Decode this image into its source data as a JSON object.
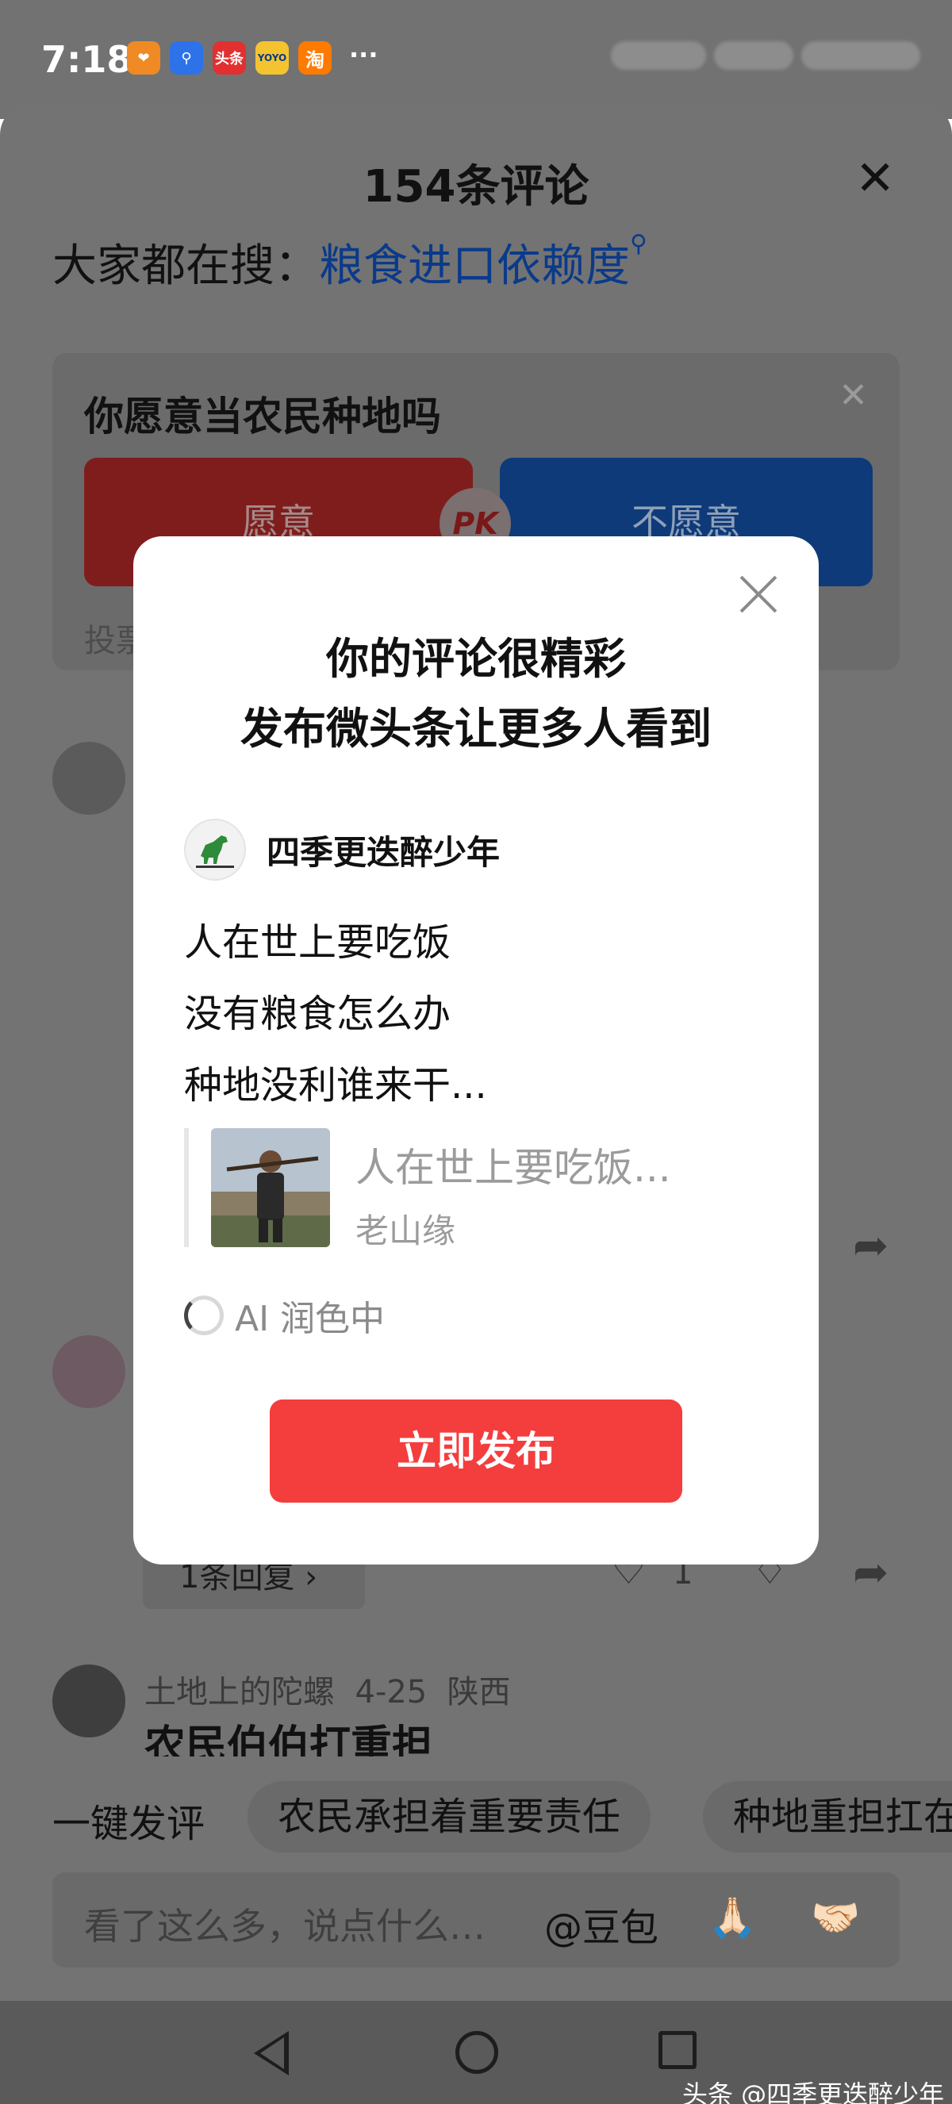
{
  "status_bar": {
    "time": "7:18",
    "app_icons": [
      {
        "name": "heart-app-icon",
        "label": "",
        "color": "#f08a24"
      },
      {
        "name": "map-pin-app-icon",
        "label": "",
        "color": "#2d72e8"
      },
      {
        "name": "toutiao-app-icon",
        "label": "头条",
        "color": "#e23030"
      },
      {
        "name": "youku-app-icon",
        "label": "YOYO",
        "color": "#f4c430"
      },
      {
        "name": "taobao-app-icon",
        "label": "淘",
        "color": "#ff7a00"
      }
    ],
    "more": "···"
  },
  "sheet": {
    "title": "154条评论",
    "close_icon": "close-icon",
    "search_prefix": "大家都在搜：",
    "search_keyword": "粮食进口依赖度"
  },
  "poll": {
    "question": "你愿意当农民种地吗",
    "yes_label": "愿意",
    "no_label": "不愿意",
    "pk_label": "PK",
    "footer_text": "投票"
  },
  "reply_pill": "1条回复 ›",
  "like_count": "1",
  "comment": {
    "username": "土地上的陀螺",
    "date": "4-25",
    "location": "陕西",
    "text": "农民伯伯打重担"
  },
  "quick_comment": {
    "label": "一键发评",
    "chips": [
      "农民承担着重要责任",
      "种地重担扛在"
    ]
  },
  "input_bar": {
    "placeholder": "看了这么多，说点什么…",
    "mention": "@豆包",
    "emojis": [
      "🙏🏻",
      "🤝🏻"
    ]
  },
  "watermark": "头条 @四季更迭醉少年",
  "modal": {
    "title_line1": "你的评论很精彩",
    "title_line2": "发布微头条让更多人看到",
    "author_name": "四季更迭醉少年",
    "body_lines": [
      "人在世上要吃饭",
      "没有粮食怎么办",
      "种地没利谁来干..."
    ],
    "quote_title": "人在世上要吃饭...",
    "quote_source": "老山缘",
    "ai_status": "AI 润色中",
    "publish_label": "立即发布"
  },
  "colors": {
    "overlay": "#737373",
    "publish_button": "#f43d3d",
    "search_keyword": "#0a3a8a"
  }
}
